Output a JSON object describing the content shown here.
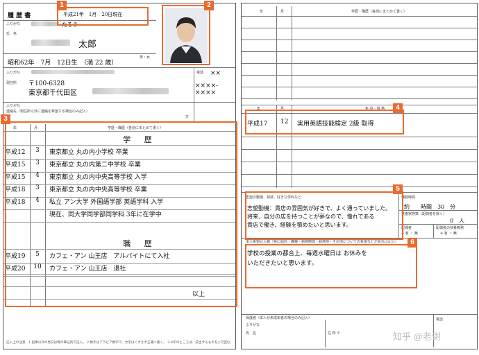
{
  "left_page": {
    "title": "履 歴 書",
    "date": "平成21年　1月　20日現在",
    "furigana_label": "ふりがな",
    "furigana_value": "たろう",
    "name_label": "氏　名",
    "name_value": "太郎",
    "birth": "昭和62年　7月　12日生　（満 22 歳）",
    "gender_options": "男・女",
    "address_label": "現住所",
    "postal": "〒100-6328",
    "address_value": "東京都千代田区",
    "phone_label": "電話",
    "phone_value1": "××",
    "phone_value2": "××××-××××",
    "contact_label": "連絡先（現住所以外に連絡を希望する場合のみ記入）",
    "contact_postal": "〒",
    "contact_kata": "方",
    "history_headers": {
      "year": "年",
      "month": "月",
      "content": "学歴・職歴（各別にまとめて書く）"
    },
    "education_title": "学 歴",
    "education_rows": [
      {
        "year": "平成12",
        "month": "3",
        "text": "東京都立 丸の内小学校 卒業"
      },
      {
        "year": "平成15",
        "month": "3",
        "text": "東京都立 丸の内第二中学校 卒業"
      },
      {
        "year": "平成15",
        "month": "4",
        "text": "東京都立 丸の内中央高等学校 入学"
      },
      {
        "year": "平成18",
        "month": "3",
        "text": "東京都立 丸の内中央高等学校 卒業"
      },
      {
        "year": "平成18",
        "month": "4",
        "text": "私立 アン大学 外国語学部 英語学科 入学"
      },
      {
        "year": "",
        "month": "",
        "text": "現在、同大学同学部同学科 3年に在学中"
      }
    ],
    "work_title": "職 歴",
    "work_rows": [
      {
        "year": "平成19",
        "month": "5",
        "text": "カフェ・アン 山王店　アルバイトにて入社"
      },
      {
        "year": "平成20",
        "month": "10",
        "text": "カフェ・アン 山王店　退社"
      }
    ],
    "closing": "以上",
    "footer_note": "記入上の注意　1.鉛筆以外の黒又は青の筆記具で記入。 2.数字はアラビア数字で、文字はくずさず正確に書く。 3.※印のところは、該当するものを○で囲む。"
  },
  "right_page": {
    "history_headers": {
      "year": "年",
      "month": "月",
      "content": "学歴・職歴（各別にまとめて書く）"
    },
    "license_headers": {
      "year": "年",
      "month": "月",
      "content": "免 許・資 格"
    },
    "license_rows": [
      {
        "year": "平成17",
        "month": "12",
        "text": "実用英語技能検定 2級 取得"
      }
    ],
    "motivation_label": "志望の動機、特技、好きな学科など",
    "motivation_text": [
      "志望動機：貴店の雰囲気が好きで、よく通っていました。",
      "将来、自分の店を持つことが夢なので、憧れである",
      "貴店で働き、経験を積めたいと思います。"
    ],
    "commute_label": "通勤時間",
    "commute_value": "約　　時間　30　分",
    "dependents_label": "扶養家族数（配偶者を除く）",
    "dependents_value": "0　人",
    "spouse_label": "配偶者",
    "spouse_value": "※ 有 ・ 無",
    "spouse_duty_label": "配偶者の扶養義務",
    "spouse_duty_value": "※ 有 ・ 無",
    "request_label": "本人希望記入欄（特に給料・職種・勤務時間・勤務地・その他についての希望などがあれば記入）",
    "request_text": [
      "学校の授業の都合上、毎週水曜日は お休みを",
      "いただきたいと思います。"
    ],
    "guardian_label": "保護者（本人が未成年者の場合のみ記入）",
    "guardian_furigana": "ふりがな",
    "guardian_name": "氏　名",
    "guardian_address": "住 所 〒",
    "guardian_phone": "電話"
  },
  "callouts": [
    "1",
    "2",
    "3",
    "4",
    "5",
    "6"
  ],
  "watermark": "知乎 @老谢"
}
